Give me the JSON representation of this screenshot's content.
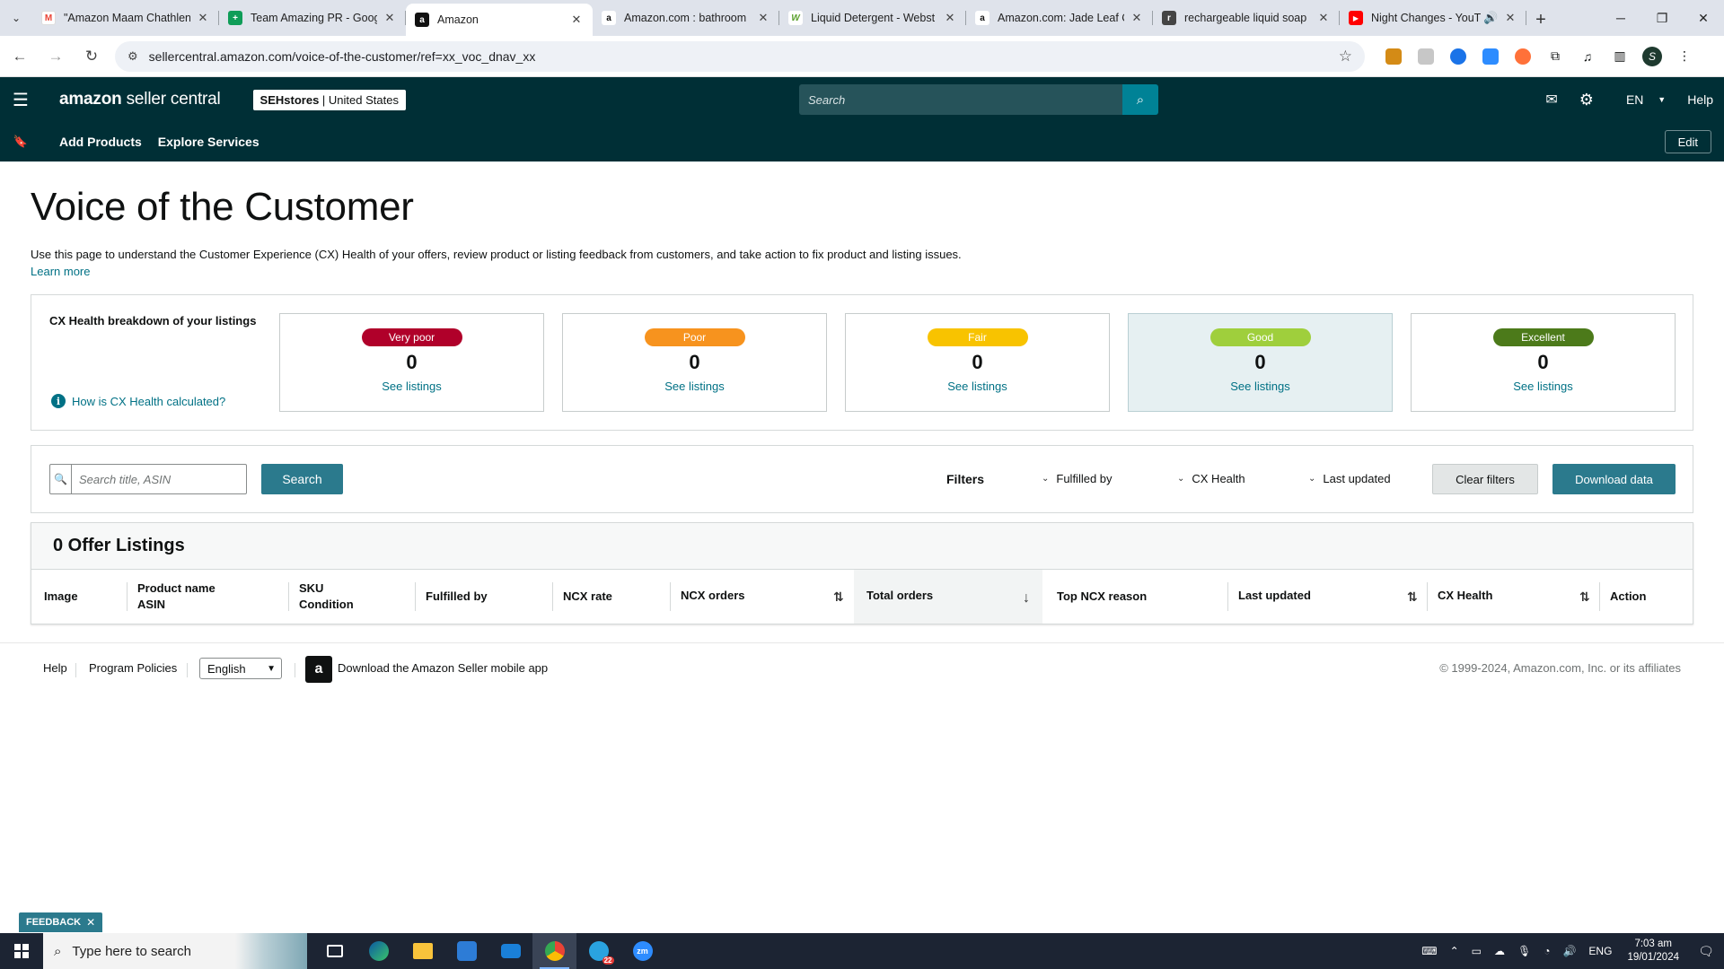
{
  "browser": {
    "tabs": [
      {
        "title": "\"Amazon Maam Chathlen",
        "icon": "gmail-icon",
        "color": "#ea4335",
        "glyph": "M"
      },
      {
        "title": "Team Amazing PR - Goog",
        "icon": "sheets-icon",
        "color": "#0f9d58",
        "glyph": "+"
      },
      {
        "title": "Amazon",
        "icon": "amazon-icon",
        "color": "#111111",
        "glyph": "a"
      },
      {
        "title": "Amazon.com : bathroom",
        "icon": "amazon-icon",
        "color": "#111111",
        "glyph": "a"
      },
      {
        "title": "Liquid Detergent - Webst",
        "icon": "webstaurant-icon",
        "color": "#5aa02c",
        "glyph": "W"
      },
      {
        "title": "Amazon.com: Jade Leaf C",
        "icon": "amazon-icon",
        "color": "#111111",
        "glyph": "a"
      },
      {
        "title": "rechargeable liquid soap",
        "icon": "product-icon",
        "color": "#444444",
        "glyph": "r"
      },
      {
        "title": "Night Changes - YouT",
        "icon": "youtube-icon",
        "color": "#ff0000",
        "glyph": "▶"
      }
    ],
    "active_tab": 2,
    "url": "sellercentral.amazon.com/voice-of-the-customer/ref=xx_voc_dnav_xx",
    "profile_initial": "S"
  },
  "header": {
    "logo_bold": "amazon",
    "logo_rest": " seller central",
    "store_name": "SEHstores",
    "store_region": "United States",
    "search_placeholder": "Search",
    "language": "EN",
    "help": "Help"
  },
  "subnav": {
    "links": [
      "Add Products",
      "Explore Services"
    ],
    "edit_label": "Edit"
  },
  "page": {
    "title": "Voice of the Customer",
    "intro": "Use this page to understand the Customer Experience (CX) Health of your offers, review product or listing feedback from customers, and take action to fix product and listing issues.",
    "learn_more": "Learn more"
  },
  "cx_health": {
    "heading": "CX Health breakdown of your listings",
    "how_link": "How is CX Health calculated?",
    "tiles": [
      {
        "label": "Very poor",
        "count": "0",
        "link": "See listings",
        "pill_bg": "#b0002a",
        "pill_fg": "#ffffff"
      },
      {
        "label": "Poor",
        "count": "0",
        "link": "See listings",
        "pill_bg": "#f7931e",
        "pill_fg": "#ffffff"
      },
      {
        "label": "Fair",
        "count": "0",
        "link": "See listings",
        "pill_bg": "#f8c300",
        "pill_fg": "#ffffff"
      },
      {
        "label": "Good",
        "count": "0",
        "link": "See listings",
        "pill_bg": "#9fcf3c",
        "pill_fg": "#ffffff"
      },
      {
        "label": "Excellent",
        "count": "0",
        "link": "See listings",
        "pill_bg": "#4c7a1a",
        "pill_fg": "#ffffff"
      }
    ]
  },
  "filters": {
    "search_placeholder": "Search title, ASIN",
    "search_button": "Search",
    "label": "Filters",
    "dropdowns": [
      "Fulfilled by",
      "CX Health",
      "Last updated"
    ],
    "clear_button": "Clear filters",
    "download_button": "Download data"
  },
  "offers": {
    "title": "0 Offer Listings",
    "columns": [
      {
        "line1": "Image",
        "line2": ""
      },
      {
        "line1": "Product name",
        "line2": "ASIN"
      },
      {
        "line1": "SKU",
        "line2": "Condition"
      },
      {
        "line1": "Fulfilled by",
        "line2": ""
      },
      {
        "line1": "NCX rate",
        "line2": ""
      },
      {
        "line1": "NCX orders",
        "line2": ""
      },
      {
        "line1": "Total orders",
        "line2": ""
      },
      {
        "line1": "Top NCX reason",
        "line2": ""
      },
      {
        "line1": "Last updated",
        "line2": ""
      },
      {
        "line1": "CX Health",
        "line2": ""
      },
      {
        "line1": "Action",
        "line2": ""
      }
    ]
  },
  "footer": {
    "help": "Help",
    "program_policies": "Program Policies",
    "language_selected": "English",
    "app_text": "Download the Amazon Seller mobile app",
    "copyright": "© 1999-2024, Amazon.com, Inc. or its affiliates"
  },
  "feedback": {
    "label": "FEEDBACK"
  },
  "taskbar": {
    "search_placeholder": "Type here to search",
    "language": "ENG",
    "time": "7:03 am",
    "date": "19/01/2024",
    "badge": "22"
  },
  "colors": {
    "header_bg": "#002f36",
    "teal_button": "#2b7a8d",
    "link": "#007185"
  }
}
